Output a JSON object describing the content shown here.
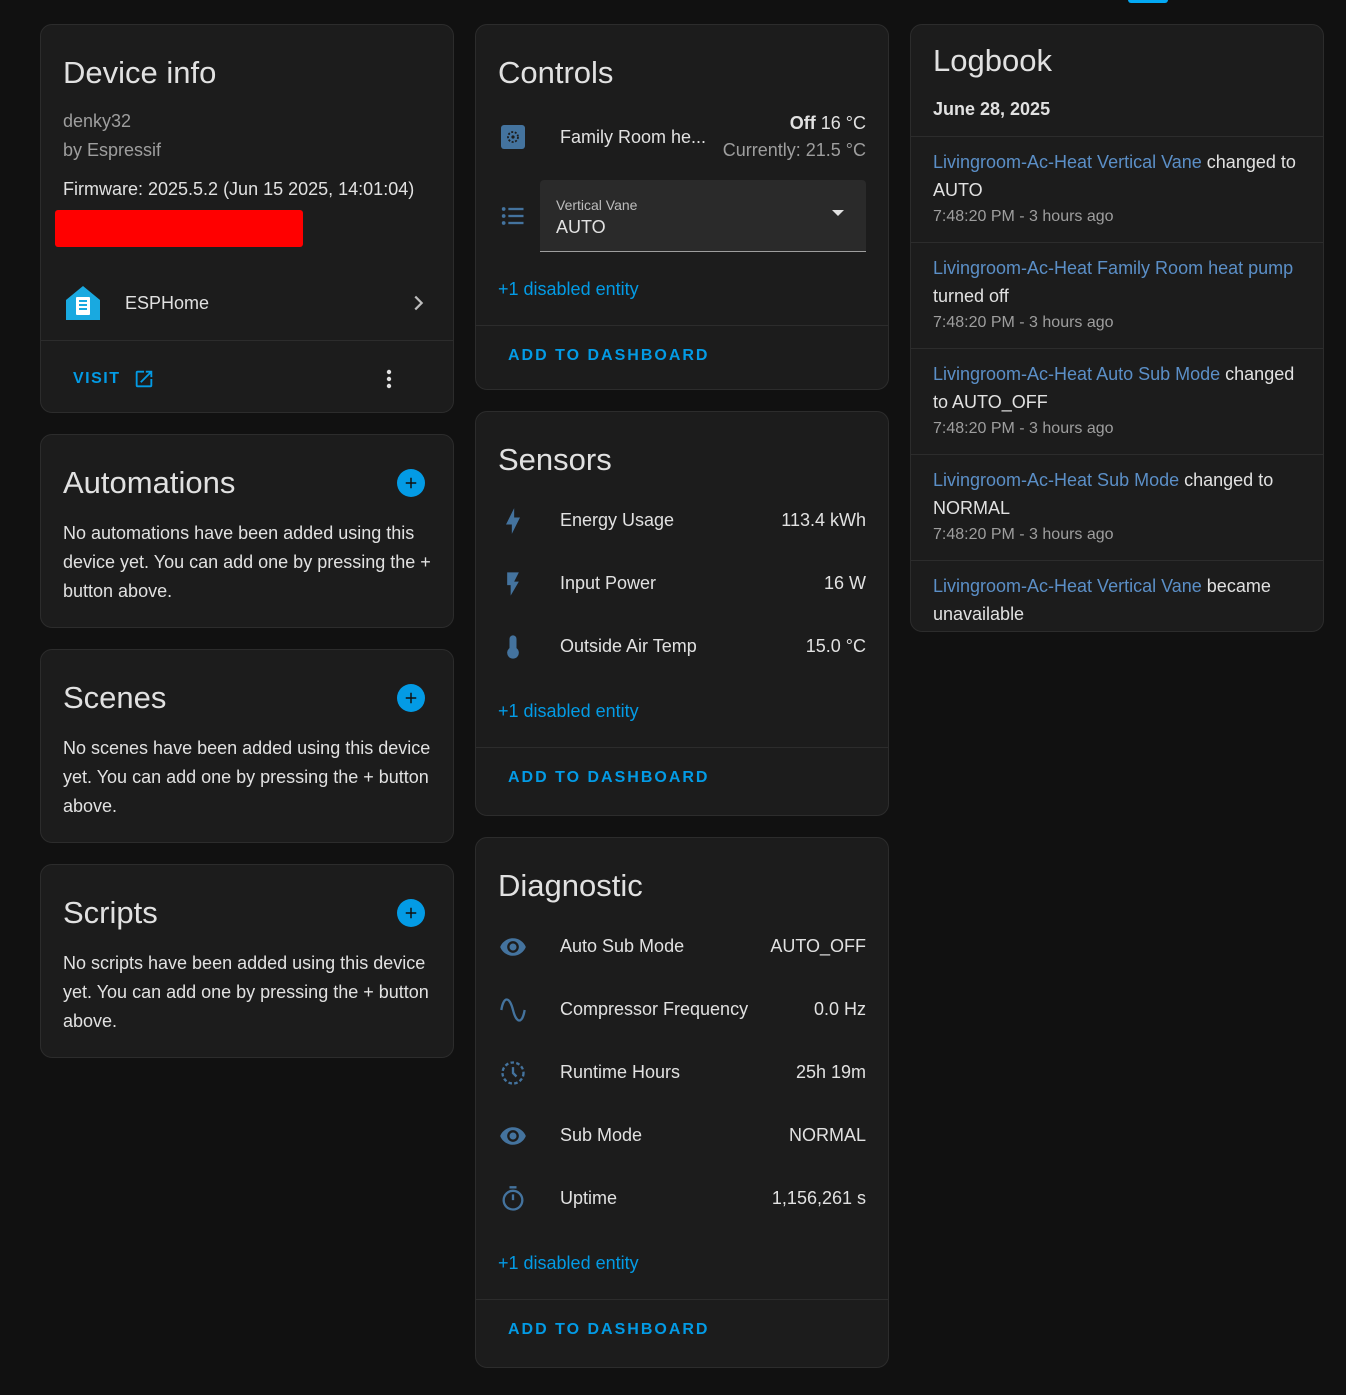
{
  "device_info": {
    "title": "Device info",
    "model": "denky32",
    "manufacturer": "by Espressif",
    "firmware": "Firmware: 2025.5.2 (Jun 15 2025, 14:01:04)",
    "integration": "ESPHome",
    "visit_label": "VISIT"
  },
  "automations": {
    "title": "Automations",
    "empty_text": "No automations have been added using this device yet. You can add one by pressing the + button above."
  },
  "scenes": {
    "title": "Scenes",
    "empty_text": "No scenes have been added using this device yet. You can add one by pressing the + button above."
  },
  "scripts": {
    "title": "Scripts",
    "empty_text": "No scripts have been added using this device yet. You can add one by pressing the + button above."
  },
  "controls": {
    "title": "Controls",
    "climate": {
      "name": "Family Room he...",
      "state_mode": "Off",
      "state_target": "16 °C",
      "state_current": "Currently: 21.5 °C"
    },
    "select": {
      "label": "Vertical Vane",
      "value": "AUTO"
    },
    "disabled": "+1 disabled entity",
    "add_to_dashboard": "ADD TO DASHBOARD"
  },
  "sensors": {
    "title": "Sensors",
    "rows": [
      {
        "name": "Energy Usage",
        "state": "113.4 kWh",
        "icon": "lightning-bolt-icon"
      },
      {
        "name": "Input Power",
        "state": "16 W",
        "icon": "flash-icon"
      },
      {
        "name": "Outside Air Temp",
        "state": "15.0 °C",
        "icon": "thermometer-icon"
      }
    ],
    "disabled": "+1 disabled entity",
    "add_to_dashboard": "ADD TO DASHBOARD"
  },
  "diagnostic": {
    "title": "Diagnostic",
    "rows": [
      {
        "name": "Auto Sub Mode",
        "state": "AUTO_OFF",
        "icon": "eye-icon"
      },
      {
        "name": "Compressor Frequency",
        "state": "0.0 Hz",
        "icon": "sine-wave-icon"
      },
      {
        "name": "Runtime Hours",
        "state": "25h 19m",
        "icon": "history-icon"
      },
      {
        "name": "Sub Mode",
        "state": "NORMAL",
        "icon": "eye-icon"
      },
      {
        "name": "Uptime",
        "state": "1,156,261 s",
        "icon": "timer-icon"
      }
    ],
    "disabled": "+1 disabled entity",
    "add_to_dashboard": "ADD TO DASHBOARD"
  },
  "logbook": {
    "title": "Logbook",
    "date": "June 28, 2025",
    "entries": [
      {
        "entity": "Livingroom-Ac-Heat Vertical Vane",
        "message": " changed to AUTO",
        "time": "7:48:20 PM - 3 hours ago"
      },
      {
        "entity": "Livingroom-Ac-Heat Family Room heat pump",
        "message": " turned off",
        "time": "7:48:20 PM - 3 hours ago"
      },
      {
        "entity": "Livingroom-Ac-Heat Auto Sub Mode",
        "message": " changed to AUTO_OFF",
        "time": "7:48:20 PM - 3 hours ago"
      },
      {
        "entity": "Livingroom-Ac-Heat Sub Mode",
        "message": " changed to NORMAL",
        "time": "7:48:20 PM - 3 hours ago"
      },
      {
        "entity": "Livingroom-Ac-Heat Vertical Vane",
        "message": " became unavailable",
        "time": ""
      }
    ]
  },
  "colors": {
    "accent": "#039be5",
    "entity_icon": "#44739e",
    "card_bg": "#1c1c1c",
    "page_bg": "#111111",
    "redaction": "#ff0000"
  }
}
